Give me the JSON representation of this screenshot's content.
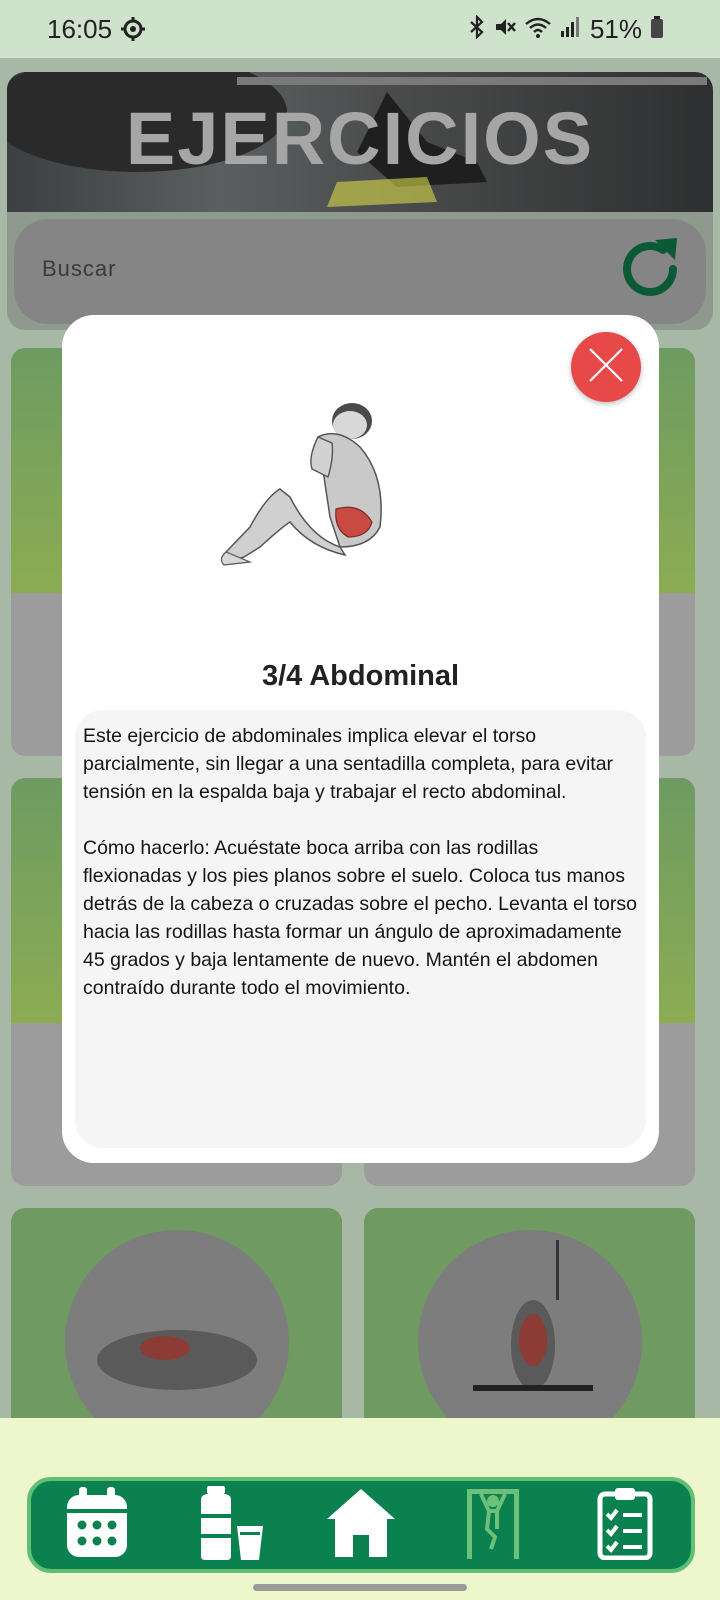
{
  "status_bar": {
    "time": "16:05",
    "battery": "51%",
    "icons": [
      "settings-gear-icon",
      "bluetooth-icon",
      "mute-icon",
      "wifi-icon",
      "signal-icon",
      "battery-icon"
    ]
  },
  "header": {
    "title": "EJERCICIOS"
  },
  "search": {
    "placeholder": "Buscar",
    "refresh_icon": "refresh-icon"
  },
  "modal": {
    "title": "3/4 Abdominal",
    "image_icon": "crunch-exercise-illustration",
    "close_icon": "close-icon",
    "description": "Este ejercicio de abdominales implica elevar el torso parcialmente, sin llegar a una sentadilla completa, para evitar tensión en la espalda baja y trabajar el recto abdominal.\n\nCómo hacerlo: Acuéstate boca arriba con las rodillas flexionadas y los pies planos sobre el suelo. Coloca tus manos detrás de la cabeza o cruzadas sobre el pecho. Levanta el torso hacia las rodillas hasta formar un ángulo de aproximadamente 45 grados y baja lentamente de nuevo. Mantén el abdomen contraído durante todo el movimiento."
  },
  "bottom_nav": {
    "items": [
      {
        "icon": "calendar-icon"
      },
      {
        "icon": "water-bottle-icon"
      },
      {
        "icon": "home-icon"
      },
      {
        "icon": "exercise-bar-icon"
      },
      {
        "icon": "checklist-icon"
      }
    ]
  },
  "colors": {
    "nav_bg": "#0b8150",
    "close_button": "#e74949",
    "accent_green": "#0b8150"
  }
}
